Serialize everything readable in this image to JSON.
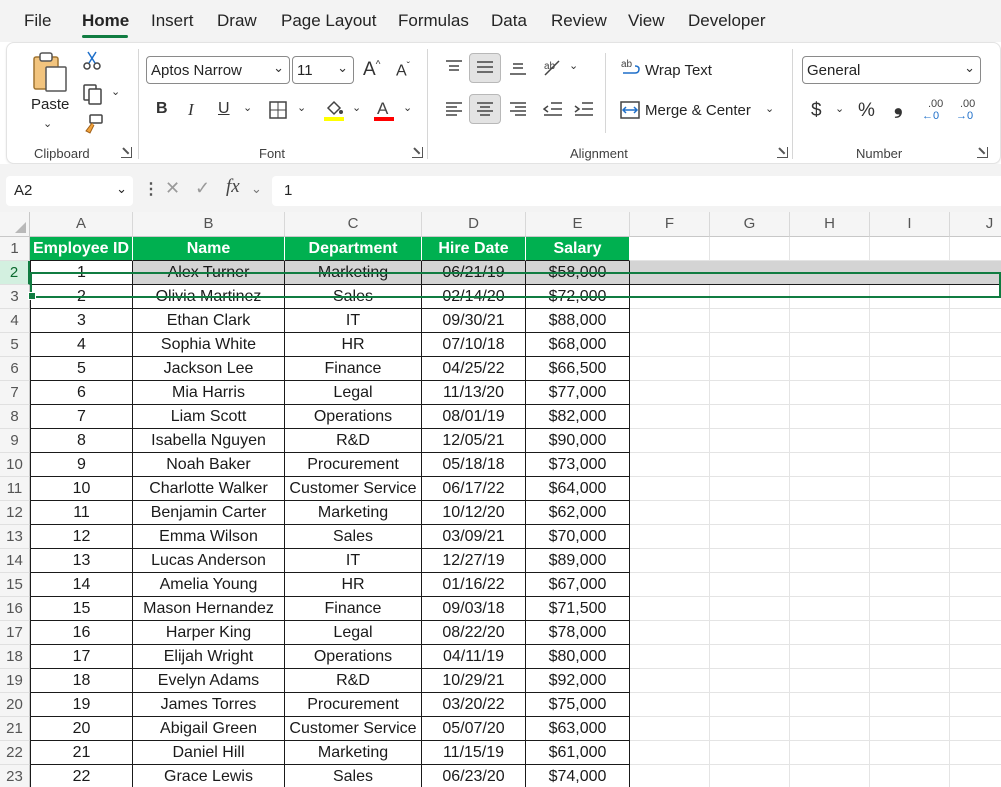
{
  "menu": {
    "tabs": [
      "File",
      "Home",
      "Insert",
      "Draw",
      "Page Layout",
      "Formulas",
      "Data",
      "Review",
      "View",
      "Developer"
    ],
    "active": "Home"
  },
  "ribbon": {
    "clipboard": {
      "label": "Clipboard",
      "paste": "Paste"
    },
    "font": {
      "label": "Font",
      "font_name": "Aptos Narrow",
      "font_size": "11",
      "grow": "A",
      "shrink": "A",
      "bold": "B",
      "italic": "I",
      "underline": "U"
    },
    "alignment": {
      "label": "Alignment",
      "wrap_text": "Wrap Text",
      "merge_center": "Merge & Center"
    },
    "number": {
      "label": "Number",
      "format": "General",
      "currency": "$",
      "percent": "%",
      "comma": "❟",
      "inc_decimal_top": ".00",
      "dec_decimal_top": ".00",
      "inc_decimal_bottom": "←0",
      "dec_decimal_bottom": "→0"
    }
  },
  "formula_bar": {
    "name_box": "A2",
    "formula": "1",
    "fx": "fx"
  },
  "columns": [
    "A",
    "B",
    "C",
    "D",
    "E",
    "F",
    "G",
    "H",
    "I",
    "J"
  ],
  "row_numbers": [
    "1",
    "2",
    "3",
    "4",
    "5",
    "6",
    "7",
    "8",
    "9",
    "10",
    "11",
    "12",
    "13",
    "14",
    "15",
    "16",
    "17",
    "18",
    "19",
    "20",
    "21",
    "22",
    "23"
  ],
  "table": {
    "headers": [
      "Employee ID",
      "Name",
      "Department",
      "Hire Date",
      "Salary"
    ],
    "rows": [
      [
        "1",
        "Alex Turner",
        "Marketing",
        "06/21/19",
        "$58,000"
      ],
      [
        "2",
        "Olivia Martinez",
        "Sales",
        "02/14/20",
        "$72,000"
      ],
      [
        "3",
        "Ethan Clark",
        "IT",
        "09/30/21",
        "$88,000"
      ],
      [
        "4",
        "Sophia White",
        "HR",
        "07/10/18",
        "$68,000"
      ],
      [
        "5",
        "Jackson Lee",
        "Finance",
        "04/25/22",
        "$66,500"
      ],
      [
        "6",
        "Mia Harris",
        "Legal",
        "11/13/20",
        "$77,000"
      ],
      [
        "7",
        "Liam Scott",
        "Operations",
        "08/01/19",
        "$82,000"
      ],
      [
        "8",
        "Isabella Nguyen",
        "R&D",
        "12/05/21",
        "$90,000"
      ],
      [
        "9",
        "Noah Baker",
        "Procurement",
        "05/18/18",
        "$73,000"
      ],
      [
        "10",
        "Charlotte Walker",
        "Customer Service",
        "06/17/22",
        "$64,000"
      ],
      [
        "11",
        "Benjamin Carter",
        "Marketing",
        "10/12/20",
        "$62,000"
      ],
      [
        "12",
        "Emma Wilson",
        "Sales",
        "03/09/21",
        "$70,000"
      ],
      [
        "13",
        "Lucas Anderson",
        "IT",
        "12/27/19",
        "$89,000"
      ],
      [
        "14",
        "Amelia Young",
        "HR",
        "01/16/22",
        "$67,000"
      ],
      [
        "15",
        "Mason Hernandez",
        "Finance",
        "09/03/18",
        "$71,500"
      ],
      [
        "16",
        "Harper King",
        "Legal",
        "08/22/20",
        "$78,000"
      ],
      [
        "17",
        "Elijah Wright",
        "Operations",
        "04/11/19",
        "$80,000"
      ],
      [
        "18",
        "Evelyn Adams",
        "R&D",
        "10/29/21",
        "$92,000"
      ],
      [
        "19",
        "James Torres",
        "Procurement",
        "03/20/22",
        "$75,000"
      ],
      [
        "20",
        "Abigail Green",
        "Customer Service",
        "05/07/20",
        "$63,000"
      ],
      [
        "21",
        "Daniel Hill",
        "Marketing",
        "11/15/19",
        "$61,000"
      ],
      [
        "22",
        "Grace Lewis",
        "Sales",
        "06/23/20",
        "$74,000"
      ]
    ]
  },
  "colors": {
    "accent": "#107c41",
    "header_fill": "#00b050",
    "highlight_row": "#d4d4d4"
  }
}
